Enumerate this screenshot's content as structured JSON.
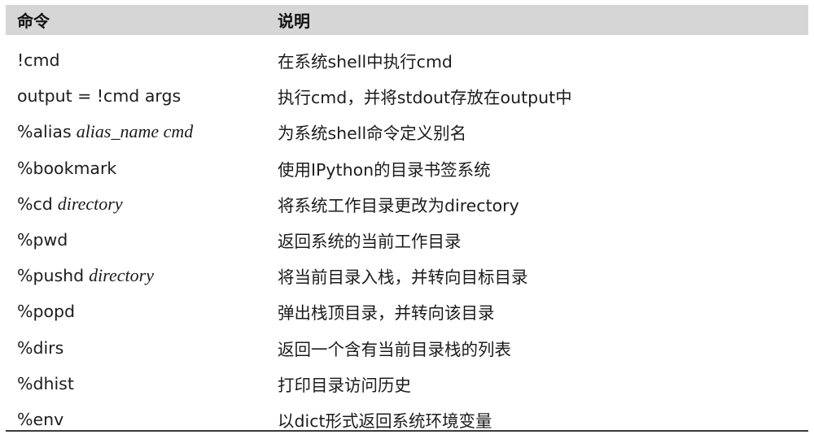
{
  "header": {
    "command": "命令",
    "description": "说明"
  },
  "rows": [
    {
      "cmd": "!cmd",
      "arg": "",
      "desc": "在系统shell中执行cmd"
    },
    {
      "cmd": "output = !cmd args",
      "arg": "",
      "desc": "执行cmd，并将stdout存放在output中"
    },
    {
      "cmd": "%alias",
      "arg": "alias_name cmd",
      "desc": "为系统shell命令定义别名"
    },
    {
      "cmd": "%bookmark",
      "arg": "",
      "desc": "使用IPython的目录书签系统"
    },
    {
      "cmd": "%cd",
      "arg": "directory",
      "desc": "将系统工作目录更改为directory"
    },
    {
      "cmd": "%pwd",
      "arg": "",
      "desc": "返回系统的当前工作目录"
    },
    {
      "cmd": "%pushd",
      "arg": "directory",
      "desc": "将当前目录入栈，并转向目标目录"
    },
    {
      "cmd": "%popd",
      "arg": "",
      "desc": "弹出栈顶目录，并转向该目录"
    },
    {
      "cmd": "%dirs",
      "arg": "",
      "desc": "返回一个含有当前目录栈的列表"
    },
    {
      "cmd": "%dhist",
      "arg": "",
      "desc": "打印目录访问历史"
    },
    {
      "cmd": "%env",
      "arg": "",
      "desc": "以dict形式返回系统环境变量"
    }
  ]
}
